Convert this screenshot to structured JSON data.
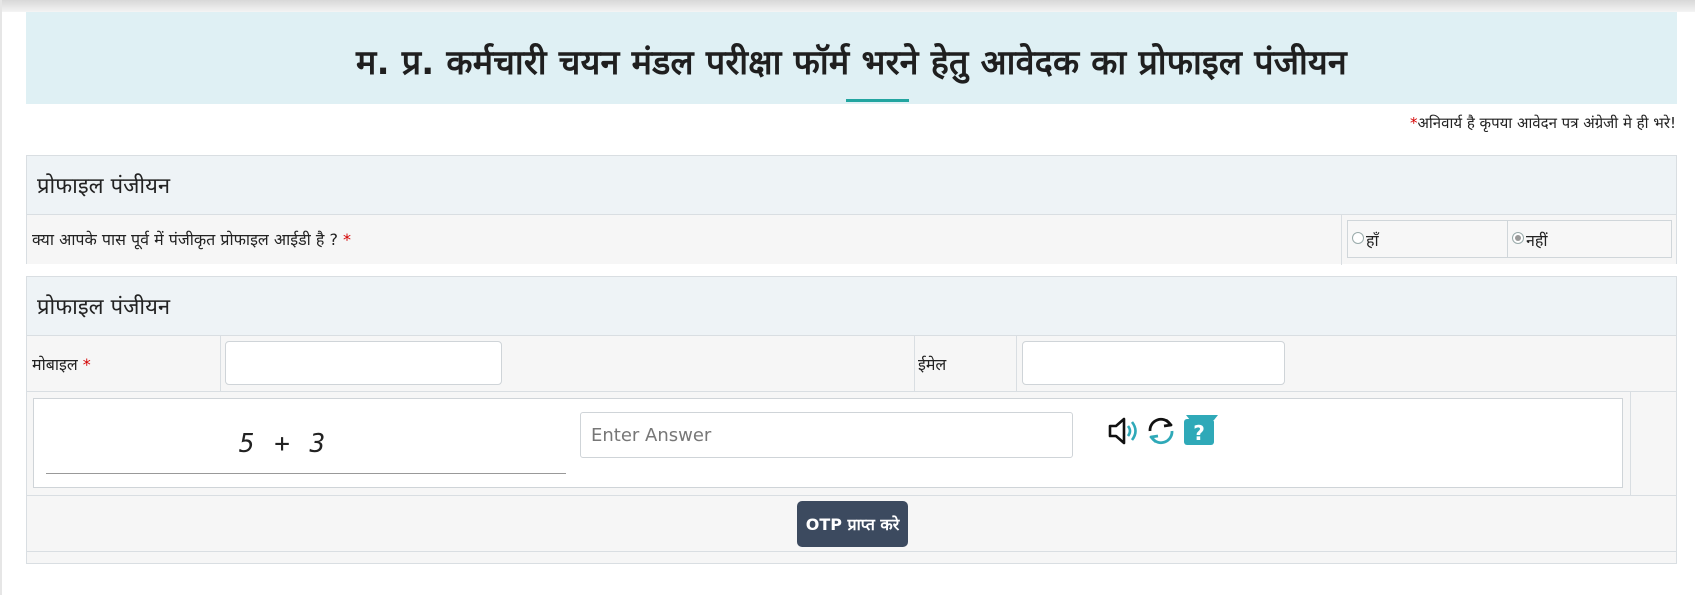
{
  "header": {
    "title": "म. प्र. कर्मचारी चयन मंडल परीक्षा फॉर्म भरने हेतु आवेदक का प्रोफाइल पंजीयन"
  },
  "note": {
    "asterisk": "*",
    "text": "अनिवार्य है कृपया आवेदन पत्र अंग्रेजी मे ही भरे!"
  },
  "panel1": {
    "title": "प्रोफाइल पंजीयन",
    "question": "क्या आपके पास पूर्व में पंजीकृत प्रोफाइल आईडी है ?",
    "required": "*",
    "options": [
      {
        "label": "हाँ",
        "checked": false
      },
      {
        "label": "नहीं",
        "checked": true
      }
    ]
  },
  "panel2": {
    "title": "प्रोफाइल पंजीयन",
    "mobile_label": "मोबाइल",
    "required": "*",
    "mobile_value": "",
    "email_label": "ईमेल",
    "email_value": "",
    "captcha": {
      "expression": "5 + 3",
      "answer_placeholder": "Enter Answer",
      "icons": [
        "speaker-icon",
        "refresh-icon",
        "help-icon"
      ]
    },
    "otp_button": "OTP प्राप्त करे"
  },
  "colors": {
    "header_bg": "#dff0f4",
    "accent": "#22a5a0",
    "required": "#d40000",
    "button": "#3c4a5f",
    "panel_bg": "#eef3f6"
  }
}
